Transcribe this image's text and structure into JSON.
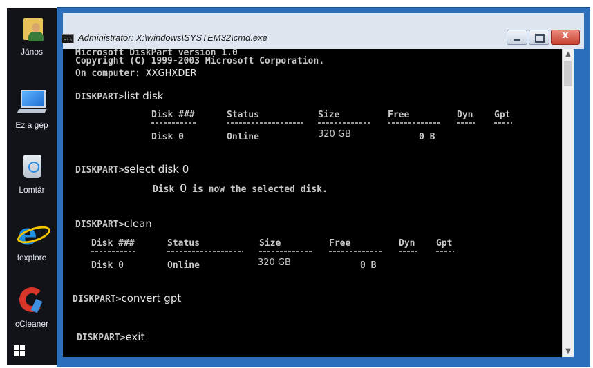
{
  "desktop": {
    "icons": [
      {
        "label": "János",
        "icon": "user-folder-icon"
      },
      {
        "label": "Ez a gép",
        "icon": "computer-icon"
      },
      {
        "label": "Lomtár",
        "icon": "recycle-bin-icon"
      },
      {
        "label": "Iexplore",
        "icon": "internet-explorer-icon"
      },
      {
        "label": "cCleaner",
        "icon": "ccleaner-icon"
      }
    ]
  },
  "window": {
    "title": "Administrator: X:\\windows\\SYSTEM32\\cmd.exe",
    "icon_label": "C:\\",
    "buttons": {
      "minimize": "minimize",
      "maximize": "maximize",
      "close": "x"
    }
  },
  "console": {
    "header": [
      "Microsoft DiskPart version 1.0",
      "Copyright (C) 1999-2003 Microsoft Corporation.",
      "On computer: "
    ],
    "computer_name": "XXGHXDER",
    "prompt": "DISKPART>",
    "cmd1": "list disk",
    "cmd2": "select disk 0",
    "selected_prefix": "Disk ",
    "selected_num": "0",
    "selected_suffix": " is now the selected disk.",
    "cmd3": "clean",
    "cmd4": "convert gpt",
    "cmd5": "exit",
    "table_headers": [
      "Disk ###",
      "Status",
      "Size",
      "Free",
      "Dyn",
      "Gpt"
    ],
    "table_row": [
      "Disk 0",
      "Online",
      "320 GB",
      "0 B",
      "",
      ""
    ]
  },
  "colors": {
    "console_bg": "#000000",
    "console_fg": "#c8c8c8",
    "window_frame": "#2b6fba",
    "close_button": "#c9402f"
  }
}
